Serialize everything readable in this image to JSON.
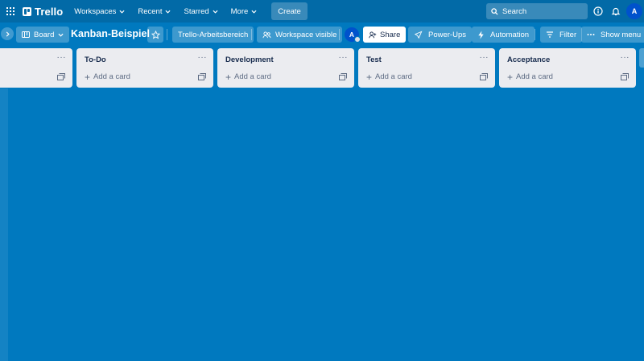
{
  "header": {
    "logo": "Trello",
    "nav": [
      {
        "label": "Workspaces"
      },
      {
        "label": "Recent"
      },
      {
        "label": "Starred"
      },
      {
        "label": "More"
      }
    ],
    "create_label": "Create",
    "search_placeholder": "Search",
    "avatar_initial": "A"
  },
  "board": {
    "view_label": "Board",
    "title": "Kanban-Beispiel",
    "workspace_label": "Trello-Arbeitsbereich",
    "visibility_label": "Workspace visible",
    "member_initial": "A",
    "share_label": "Share",
    "powerups_label": "Power-Ups",
    "automation_label": "Automation",
    "filter_label": "Filter",
    "show_menu_label": "Show menu"
  },
  "lists": [
    {
      "title": "",
      "add_label": ""
    },
    {
      "title": "To-Do",
      "add_label": "Add a card"
    },
    {
      "title": "Development",
      "add_label": "Add a card"
    },
    {
      "title": "Test",
      "add_label": "Add a card"
    },
    {
      "title": "Acceptance",
      "add_label": "Add a card"
    }
  ],
  "colors": {
    "board_bg": "#0079bf",
    "header_bg": "#026aa7",
    "list_bg": "#ebecf0"
  }
}
